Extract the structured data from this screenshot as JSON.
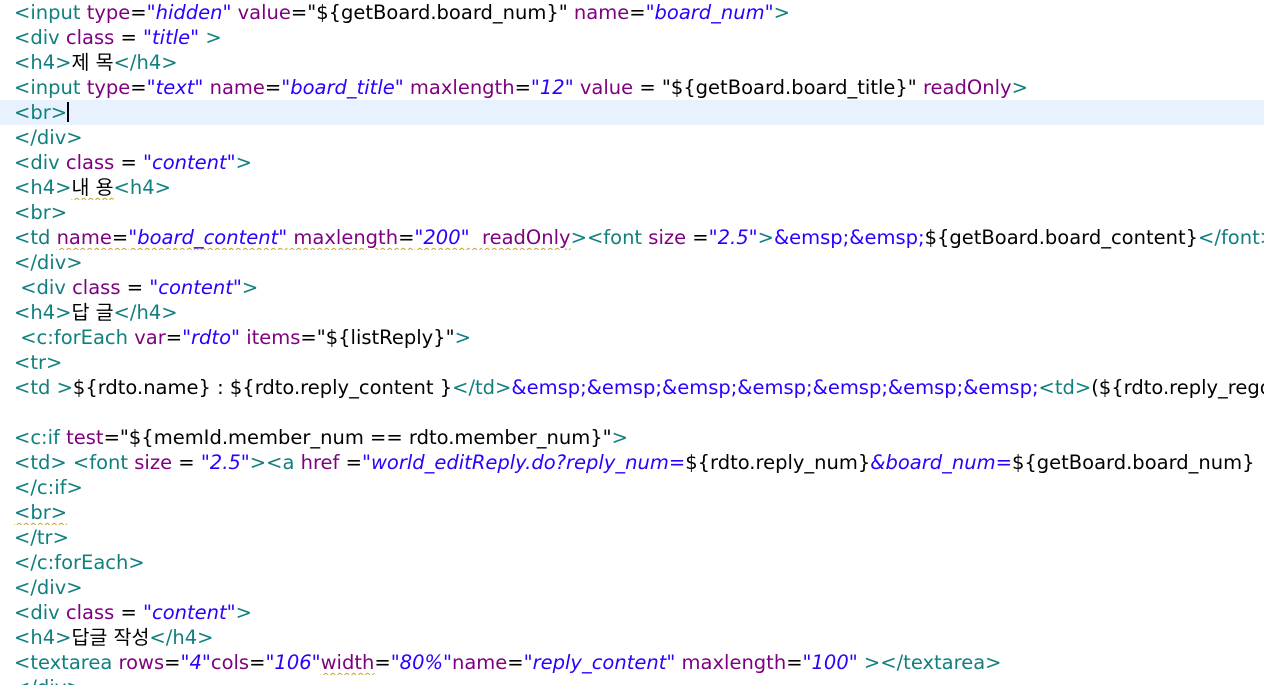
{
  "colors": {
    "tag": "#127f7f",
    "attr": "#7f007f",
    "value": "#2a00ff",
    "text": "#000000",
    "entity": "#2a00ff",
    "current_line_bg": "#e8f2fe"
  },
  "editor": {
    "current_line": 4,
    "lines": [
      [
        [
          "tg",
          "<input "
        ],
        [
          "at",
          "type"
        ],
        [
          "tx",
          "="
        ],
        [
          "vl",
          "\"hidden\""
        ],
        [
          "tx",
          " "
        ],
        [
          "at",
          "value"
        ],
        [
          "tx",
          "=\"${getBoard.board_num}\" "
        ],
        [
          "at",
          "name"
        ],
        [
          "tx",
          "="
        ],
        [
          "vl",
          "\"board_num\""
        ],
        [
          "tg",
          ">"
        ]
      ],
      [
        [
          "tg",
          "<div "
        ],
        [
          "at",
          "class"
        ],
        [
          "tx",
          " = "
        ],
        [
          "vl",
          "\"title\""
        ],
        [
          "tx",
          " "
        ],
        [
          "tg",
          ">"
        ]
      ],
      [
        [
          "tg",
          "<h4>"
        ],
        [
          "tx",
          "제 목"
        ],
        [
          "tg",
          "</h4>"
        ]
      ],
      [
        [
          "tg",
          "<input "
        ],
        [
          "at",
          "type"
        ],
        [
          "tx",
          "="
        ],
        [
          "vl",
          "\"text\""
        ],
        [
          "tx",
          " "
        ],
        [
          "at",
          "name"
        ],
        [
          "tx",
          "="
        ],
        [
          "vl",
          "\"board_title\""
        ],
        [
          "tx",
          " "
        ],
        [
          "at",
          "maxlength"
        ],
        [
          "tx",
          "="
        ],
        [
          "vl",
          "\"12\""
        ],
        [
          "tx",
          " "
        ],
        [
          "at",
          "value"
        ],
        [
          "tx",
          " = \"${getBoard.board_title}\" "
        ],
        [
          "at",
          "readOnly"
        ],
        [
          "tg",
          ">"
        ]
      ],
      [
        [
          "tg",
          "<br>"
        ],
        [
          "caret",
          ""
        ]
      ],
      [
        [
          "tg",
          "</div>"
        ]
      ],
      [
        [
          "tg",
          "<div "
        ],
        [
          "at",
          "class"
        ],
        [
          "tx",
          " = "
        ],
        [
          "vl",
          "\"content\""
        ],
        [
          "tg",
          ">"
        ]
      ],
      [
        [
          "tg",
          "<h4>"
        ],
        [
          "tx sq",
          "내 용"
        ],
        [
          "tg",
          "<h4>"
        ]
      ],
      [
        [
          "tg",
          "<br>"
        ]
      ],
      [
        [
          "tg",
          "<td "
        ],
        [
          "at sq",
          "name"
        ],
        [
          "tx sq",
          "="
        ],
        [
          "vl sq",
          "\"board_content\""
        ],
        [
          "tx sq",
          " "
        ],
        [
          "at sq",
          "maxlength"
        ],
        [
          "tx sq",
          "="
        ],
        [
          "vl sq",
          "\"200\""
        ],
        [
          "tx sq",
          "  "
        ],
        [
          "at sq",
          "readOnly"
        ],
        [
          "tg",
          ">"
        ],
        [
          "tg",
          "<font "
        ],
        [
          "at",
          "size"
        ],
        [
          "tx",
          " ="
        ],
        [
          "vl",
          "\"2.5\""
        ],
        [
          "tg",
          ">"
        ],
        [
          "en",
          "&emsp;&emsp;"
        ],
        [
          "tx",
          "${getBoard.board_content}"
        ],
        [
          "tg",
          "</font>"
        ]
      ],
      [
        [
          "tg",
          "</div>"
        ]
      ],
      [
        [
          "tx",
          " "
        ],
        [
          "tg",
          "<div "
        ],
        [
          "at",
          "class"
        ],
        [
          "tx",
          " = "
        ],
        [
          "vl",
          "\"content\""
        ],
        [
          "tg",
          ">"
        ]
      ],
      [
        [
          "tg",
          "<h4>"
        ],
        [
          "tx",
          "답 글"
        ],
        [
          "tg",
          "</h4>"
        ]
      ],
      [
        [
          "tx",
          " "
        ],
        [
          "tg",
          "<c:forEach "
        ],
        [
          "at",
          "var"
        ],
        [
          "tx",
          "="
        ],
        [
          "vl",
          "\"rdto\""
        ],
        [
          "tx",
          " "
        ],
        [
          "at",
          "items"
        ],
        [
          "tx",
          "=\"${listReply}\""
        ],
        [
          "tg",
          ">"
        ]
      ],
      [
        [
          "tg",
          "<tr>"
        ]
      ],
      [
        [
          "tg",
          "<td "
        ],
        [
          "tg",
          ">"
        ],
        [
          "tx",
          "${rdto.name} : ${rdto.reply_content }"
        ],
        [
          "tg",
          "</td>"
        ],
        [
          "en",
          "&emsp;&emsp;&emsp;&emsp;&emsp;&emsp;&emsp;"
        ],
        [
          "tg",
          "<td>"
        ],
        [
          "tx",
          "(${rdto.reply_regdate})"
        ]
      ],
      [],
      [
        [
          "tg",
          "<c:if "
        ],
        [
          "at",
          "test"
        ],
        [
          "tx",
          "=\"${memId.member_num == rdto.member_num}\""
        ],
        [
          "tg",
          ">"
        ]
      ],
      [
        [
          "tg",
          "<td>"
        ],
        [
          "tx",
          " "
        ],
        [
          "tg",
          "<font "
        ],
        [
          "at",
          "size"
        ],
        [
          "tx",
          " = "
        ],
        [
          "vl",
          "\"2.5\""
        ],
        [
          "tg",
          ">"
        ],
        [
          "tg",
          "<a "
        ],
        [
          "at",
          "href"
        ],
        [
          "tx",
          " ="
        ],
        [
          "vl",
          "\"world_editReply.do?reply_num="
        ],
        [
          "tx",
          "${rdto.reply_num}"
        ],
        [
          "vl",
          "&board_num="
        ],
        [
          "tx",
          "${getBoard.board_num}"
        ]
      ],
      [
        [
          "tg",
          "</c:if>"
        ]
      ],
      [
        [
          "tg sq",
          "<br>"
        ]
      ],
      [
        [
          "tg",
          "</tr>"
        ]
      ],
      [
        [
          "tg",
          "</c:forEach>"
        ]
      ],
      [
        [
          "tg",
          "</div>"
        ]
      ],
      [
        [
          "tg",
          "<div "
        ],
        [
          "at",
          "class"
        ],
        [
          "tx",
          " = "
        ],
        [
          "vl",
          "\"content\""
        ],
        [
          "tg",
          ">"
        ]
      ],
      [
        [
          "tg",
          "<h4>"
        ],
        [
          "tx",
          "답글 작성"
        ],
        [
          "tg",
          "</h4>"
        ]
      ],
      [
        [
          "tg",
          "<textarea "
        ],
        [
          "at",
          "rows"
        ],
        [
          "tx",
          "="
        ],
        [
          "vl",
          "\"4\""
        ],
        [
          "at",
          "cols"
        ],
        [
          "tx",
          "="
        ],
        [
          "vl",
          "\"106\""
        ],
        [
          "at sq",
          "width"
        ],
        [
          "tx",
          "="
        ],
        [
          "vl",
          "\"80%\""
        ],
        [
          "at",
          "name"
        ],
        [
          "tx",
          "="
        ],
        [
          "vl",
          "\"reply_content\""
        ],
        [
          "tx",
          " "
        ],
        [
          "at",
          "maxlength"
        ],
        [
          "tx",
          "="
        ],
        [
          "vl",
          "\"100\""
        ],
        [
          "tx",
          " "
        ],
        [
          "tg",
          "></textarea>"
        ]
      ],
      [
        [
          "tg",
          "</div>"
        ]
      ]
    ]
  }
}
